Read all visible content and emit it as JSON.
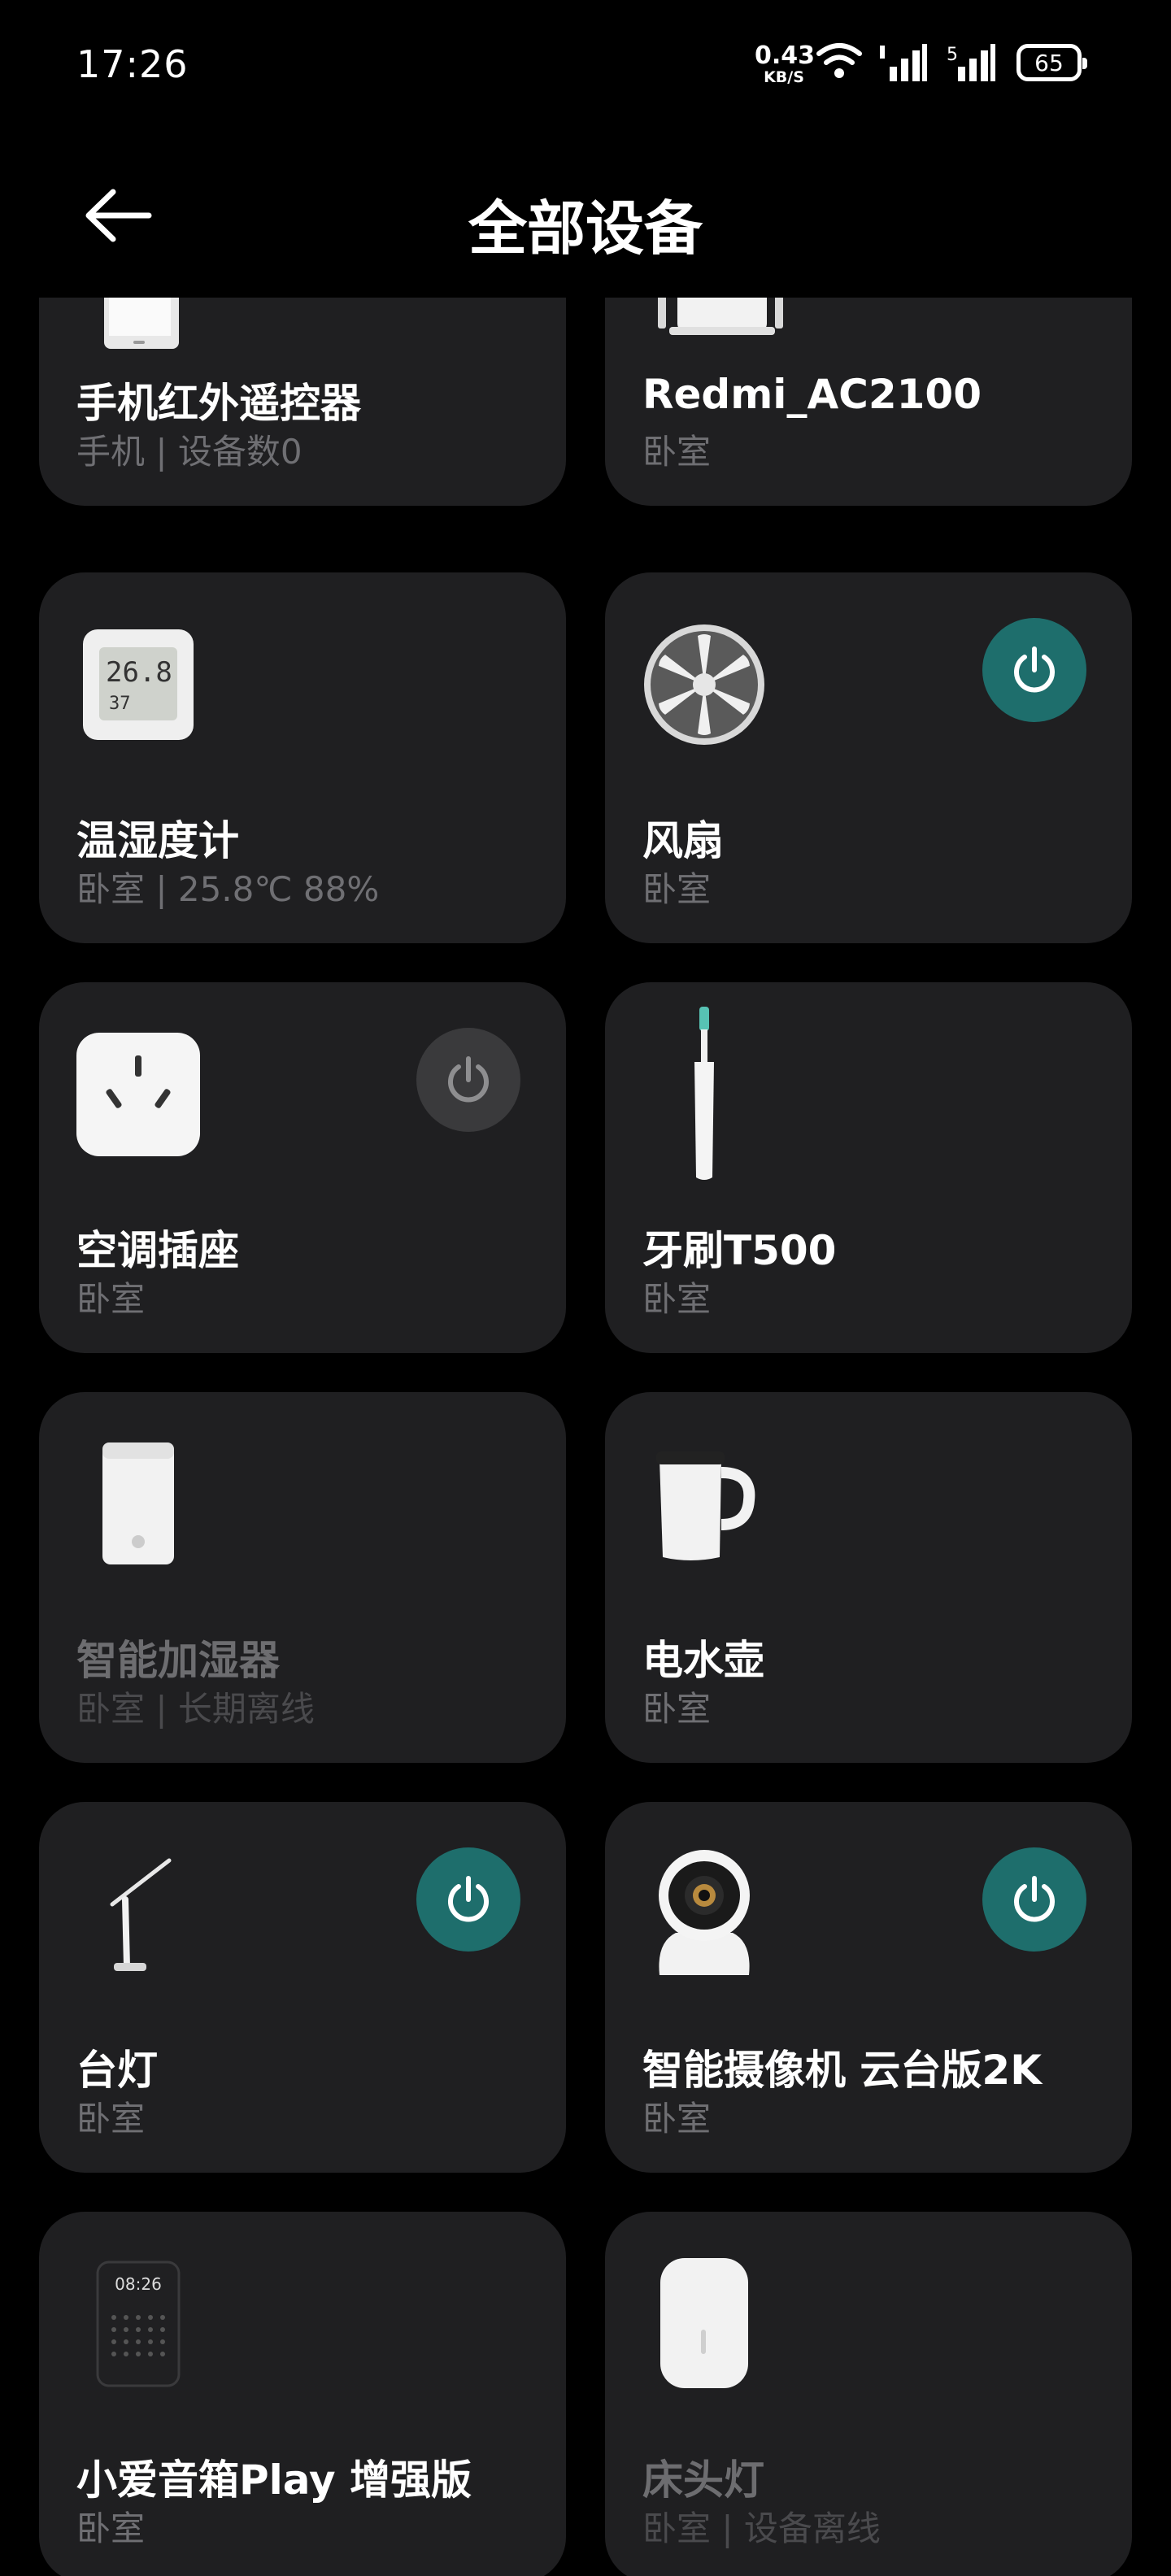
{
  "status_bar": {
    "time": "17:26",
    "net_speed_value": "0.43",
    "net_speed_unit": "KB/S",
    "battery": "65"
  },
  "header": {
    "title": "全部设备"
  },
  "colors": {
    "background": "#000000",
    "card": "#1f1f21",
    "power_on": "#1e6e6c",
    "power_off": "#3a3a3c",
    "subtext": "#6f6f73"
  },
  "devices": [
    {
      "name": "手机红外遥控器",
      "sub": "手机 | 设备数0",
      "icon": "phone-remote-icon",
      "power": null,
      "offline": false
    },
    {
      "name": "Redmi_AC2100",
      "sub": "卧室",
      "icon": "router-icon",
      "power": null,
      "offline": false
    },
    {
      "name": "温湿度计",
      "sub": "卧室 | 25.8℃ 88%",
      "icon": "thermometer-hygrometer-icon",
      "power": null,
      "offline": false,
      "display_top": "26.8",
      "display_bottom": "37"
    },
    {
      "name": "风扇",
      "sub": "卧室",
      "icon": "fan-icon",
      "power": "on",
      "offline": false
    },
    {
      "name": "空调插座",
      "sub": "卧室",
      "icon": "smart-plug-icon",
      "power": "off",
      "offline": false
    },
    {
      "name": "牙刷T500",
      "sub": "卧室",
      "icon": "toothbrush-icon",
      "power": null,
      "offline": false
    },
    {
      "name": "智能加湿器",
      "sub": "卧室 | 长期离线",
      "icon": "humidifier-icon",
      "power": null,
      "offline": true
    },
    {
      "name": "电水壶",
      "sub": "卧室",
      "icon": "kettle-icon",
      "power": null,
      "offline": false
    },
    {
      "name": "台灯",
      "sub": "卧室",
      "icon": "desk-lamp-icon",
      "power": "on",
      "offline": false
    },
    {
      "name": "智能摄像机 云台版2K",
      "sub": "卧室",
      "icon": "camera-icon",
      "power": "on",
      "offline": false
    },
    {
      "name": "小爱音箱Play 增强版",
      "sub": "卧室",
      "icon": "speaker-icon",
      "power": null,
      "offline": false,
      "display": "08:26"
    },
    {
      "name": "床头灯",
      "sub": "卧室 | 设备离线",
      "icon": "bedside-lamp-icon",
      "power": null,
      "offline": true
    }
  ]
}
